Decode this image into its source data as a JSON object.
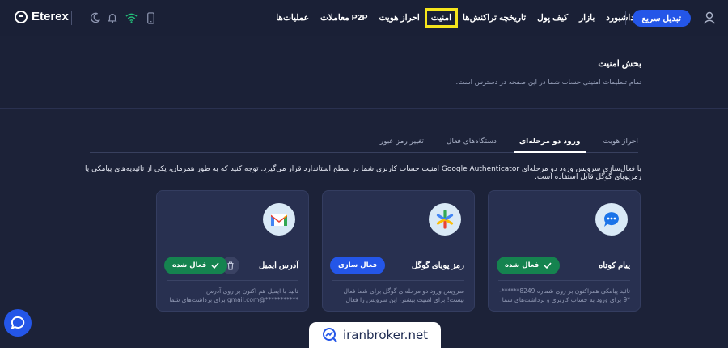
{
  "header": {
    "logo_text": "Eterex",
    "nav": [
      {
        "label": "داشبورد"
      },
      {
        "label": "بازار"
      },
      {
        "label": "کیف پول"
      },
      {
        "label": "تاریخچه تراکنش‌ها"
      },
      {
        "label": "امنیت",
        "active": true
      },
      {
        "label": "احراز هویت"
      },
      {
        "label": "معاملات P2P"
      },
      {
        "label": "عملیات‌ها"
      }
    ],
    "cta_label": "تبدیل سریع"
  },
  "security": {
    "title": "بخش امنیت",
    "subtitle": "تمام تنظیمات امنیتی حساب شما در این صفحه در دسترس است."
  },
  "tabs": [
    {
      "label": "احراز هویت"
    },
    {
      "label": "ورود دو مرحله‌ای",
      "active": true
    },
    {
      "label": "دستگاه‌های فعال"
    },
    {
      "label": "تغییر رمز عبور"
    }
  ],
  "description": "با فعال‌سازی سرویس ورود دو مرحله‌ای Google Authenticator امنیت حساب کاربری شما در سطح استاندارد قرار می‌گیرد. توجه کنید که به طور همزمان، یکی از تائیدیه‌های پیامکی یا رمزپویای گوگل قابل استفاده است.",
  "cards": [
    {
      "title": "پیام کوتاه",
      "icon": "sms-bubble-icon",
      "button": "فعال شده",
      "status": "active",
      "desc": "تائید پیامکی همراکنون بر روی شماره 8249******-*9 برای ورود به حساب کاربری و برداشت‌های شما فعال است."
    },
    {
      "title": "رمز پویای گوگل",
      "icon": "google-authenticator-icon",
      "button": "فعال سازی",
      "status": "inactive",
      "desc": "سرویس ورود دو مرحله‌ای گوگل برای شما فعال نیست! برای امنیت بیشتر، این سرویس را فعال کنید."
    },
    {
      "title": "آدرس ایمیل",
      "icon": "gmail-icon",
      "button": "فعال شده",
      "status": "active",
      "desc": "تائید با ایمیل هم اکنون بر روی آدرس ***********@gmail.com برای برداشت‌های شما فعال است."
    }
  ],
  "watermark": "iranbroker.net",
  "colors": {
    "accent": "#2456e8",
    "success": "#15834f",
    "highlight": "#f5e51c",
    "background": "#1c2238",
    "card": "#283050"
  }
}
